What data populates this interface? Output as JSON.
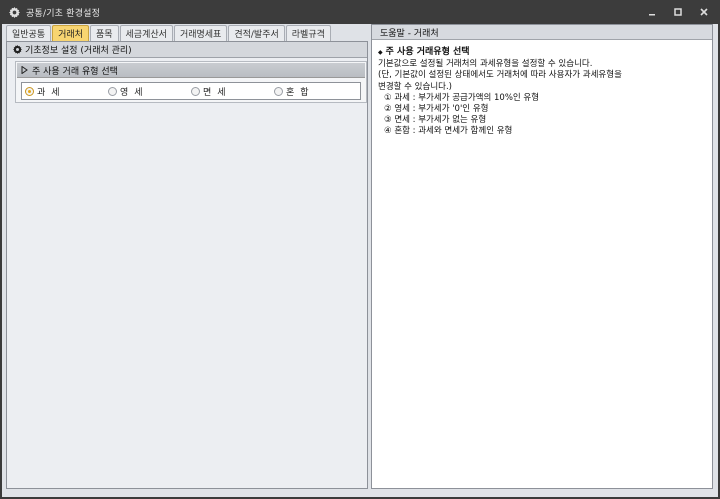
{
  "window": {
    "title": "공통/기초 환경설정",
    "icon": "gear-icon",
    "buttons": [
      "minimize-icon",
      "maximize-icon",
      "close-icon"
    ]
  },
  "tabs": [
    {
      "label": "일반공통",
      "active": false
    },
    {
      "label": "거래처",
      "active": true
    },
    {
      "label": "품목",
      "active": false
    },
    {
      "label": "세금계산서",
      "active": false
    },
    {
      "label": "거래명세표",
      "active": false
    },
    {
      "label": "견적/발주서",
      "active": false
    },
    {
      "label": "라벨규격",
      "active": false
    }
  ],
  "section": {
    "title": "기초정보 설정 (거래처 관리)",
    "icon": "gear-icon"
  },
  "group": {
    "title": "주 사용 거래 유형 선택",
    "options": [
      {
        "label": "과세",
        "checked": true
      },
      {
        "label": "영세",
        "checked": false
      },
      {
        "label": "면세",
        "checked": false
      },
      {
        "label": "혼합",
        "checked": false
      }
    ]
  },
  "help": {
    "header": "도움말 - 거래처",
    "heading": "주 사용 거래유형 선택",
    "lines": [
      "기본값으로 설정될 거래처의 과세유형을 설정할 수 있습니다.",
      "(단, 기본값이 설정된 상태에서도 거래처에 따라 사용자가 과세유형을",
      " 변경할 수 있습니다.)"
    ],
    "items": [
      "① 과세 : 부가세가 공급가액의 10%인 유형",
      "② 영세 : 부가세가 '0'인 유형",
      "③ 면세 : 부가세가 없는 유형",
      "④ 혼합 : 과세와 면세가 함께인 유형"
    ]
  },
  "colors": {
    "active_tab": "#f8d571",
    "titlebar": "#3c3c3c",
    "radio_checked": "#e6a817"
  }
}
